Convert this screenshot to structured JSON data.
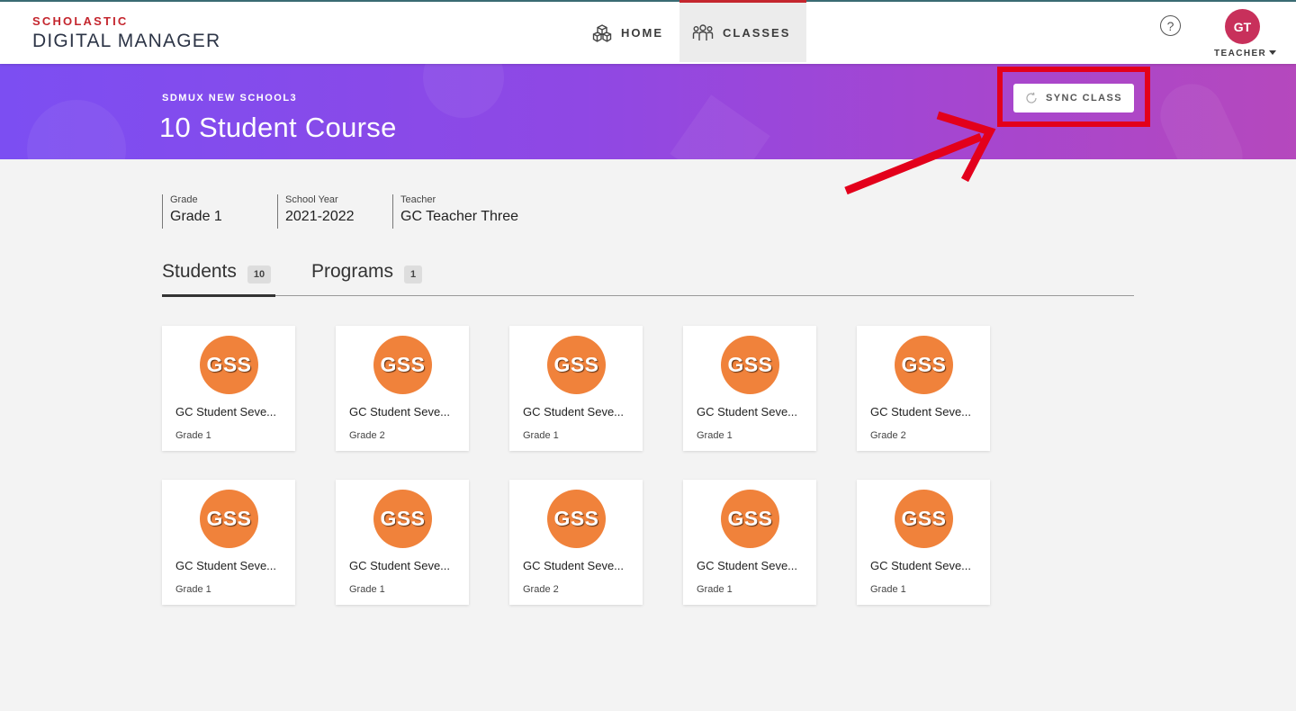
{
  "brand": {
    "top": "SCHOLASTIC",
    "bottom": "DIGITAL MANAGER"
  },
  "nav": {
    "home": {
      "label": "HOME",
      "icon": "cubes-icon"
    },
    "classes": {
      "label": "CLASSES",
      "icon": "people-icon",
      "active": true
    }
  },
  "header": {
    "help": "?",
    "avatar_initials": "GT",
    "role": "TEACHER"
  },
  "banner": {
    "school": "SDMUX NEW SCHOOL3",
    "course": "10 Student Course",
    "sync_label": "SYNC CLASS"
  },
  "meta": [
    {
      "label": "Grade",
      "value": "Grade 1"
    },
    {
      "label": "School Year",
      "value": "2021-2022"
    },
    {
      "label": "Teacher",
      "value": "GC Teacher Three"
    }
  ],
  "tabs": [
    {
      "label": "Students",
      "count": "10",
      "active": true
    },
    {
      "label": "Programs",
      "count": "1",
      "active": false
    }
  ],
  "students": [
    {
      "initials": "GSS",
      "name": "GC Student Seve...",
      "grade": "Grade 1"
    },
    {
      "initials": "GSS",
      "name": "GC Student Seve...",
      "grade": "Grade 2"
    },
    {
      "initials": "GSS",
      "name": "GC Student Seve...",
      "grade": "Grade 1"
    },
    {
      "initials": "GSS",
      "name": "GC Student Seve...",
      "grade": "Grade 1"
    },
    {
      "initials": "GSS",
      "name": "GC Student Seve...",
      "grade": "Grade 2"
    },
    {
      "initials": "GSS",
      "name": "GC Student Seve...",
      "grade": "Grade 1"
    },
    {
      "initials": "GSS",
      "name": "GC Student Seve...",
      "grade": "Grade 1"
    },
    {
      "initials": "GSS",
      "name": "GC Student Seve...",
      "grade": "Grade 2"
    },
    {
      "initials": "GSS",
      "name": "GC Student Seve...",
      "grade": "Grade 1"
    },
    {
      "initials": "GSS",
      "name": "GC Student Seve...",
      "grade": "Grade 1"
    }
  ],
  "colors": {
    "brand_red": "#c4262e",
    "avatar": "#c8305b",
    "badge": "#f0823b",
    "annotation": "#e3001b"
  }
}
